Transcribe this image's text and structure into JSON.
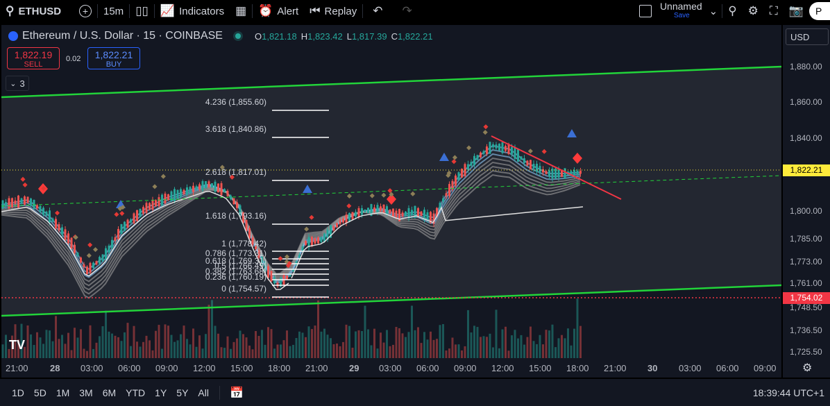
{
  "topbar": {
    "symbol": "ETHUSD",
    "interval": "15m",
    "indicators_label": "Indicators",
    "alert_label": "Alert",
    "replay_label": "Replay",
    "layout_name": "Unnamed",
    "save_label": "Save",
    "user_initial": "P"
  },
  "legend": {
    "title": "Ethereum / U.S. Dollar · 15 · COINBASE",
    "o_label": "O",
    "o_value": "1,821.18",
    "h_label": "H",
    "h_value": "1,823.42",
    "l_label": "L",
    "l_value": "1,817.39",
    "c_label": "C",
    "c_value": "1,822.21",
    "sell_price": "1,822.19",
    "sell_label": "SELL",
    "spread": "0.02",
    "buy_price": "1,822.21",
    "buy_label": "BUY",
    "indicator_count": "3"
  },
  "currency": "USD",
  "colors": {
    "up": "#26a69a",
    "down": "#ef5350",
    "channel": "#22d43a",
    "fib": "#ffffff",
    "current": "#ffeb3b",
    "support": "#f23645"
  },
  "price_axis": {
    "ticks": [
      "1,880.00",
      "1,860.00",
      "1,840.00",
      "1,800.00",
      "1,785.00",
      "1,773.00",
      "1,761.00",
      "1,748.50",
      "1,736.50",
      "1,725.50"
    ],
    "current_price": "1,822.21",
    "support_price": "1,754.02"
  },
  "time_axis": {
    "ticks": [
      "21:00",
      "28",
      "03:00",
      "06:00",
      "09:00",
      "12:00",
      "15:00",
      "18:00",
      "21:00",
      "29",
      "03:00",
      "06:00",
      "09:00",
      "12:00",
      "15:00",
      "18:00",
      "21:00",
      "30",
      "03:00",
      "06:00",
      "09:00"
    ]
  },
  "fib_levels": [
    {
      "label": "4.236 (1,855.60)"
    },
    {
      "label": "3.618 (1,840.86)"
    },
    {
      "label": "2.618 (1,817.01)"
    },
    {
      "label": "1.618 (1,793.16)"
    },
    {
      "label": "1 (1,778.42)"
    },
    {
      "label": "0.786 (1,773.31)"
    },
    {
      "label": "0.618 (1,769.31)"
    },
    {
      "label": "0.5 (1,766.49)"
    },
    {
      "label": "0.382 (1,763.68)"
    },
    {
      "label": "0.236 (1,760.19)"
    },
    {
      "label": "0 (1,754.57)"
    }
  ],
  "bottombar": {
    "ranges": [
      "1D",
      "5D",
      "1M",
      "3M",
      "6M",
      "YTD",
      "1Y",
      "5Y",
      "All"
    ],
    "clock": "18:39:44 UTC+1"
  }
}
